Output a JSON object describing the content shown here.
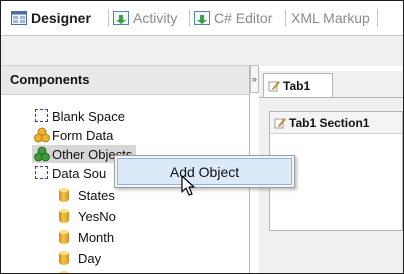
{
  "tabs": [
    {
      "label": "Designer",
      "icon": "designer-icon",
      "active": true
    },
    {
      "label": "Activity",
      "icon": "activity-icon",
      "active": false
    },
    {
      "label": "C# Editor",
      "icon": "csharp-editor-icon",
      "active": false
    },
    {
      "label": "XML Markup",
      "icon": "xml-icon",
      "active": false
    }
  ],
  "components": {
    "title": "Components",
    "collapse_glyph": "»",
    "items": [
      {
        "label": "Blank Space",
        "icon": "dashed-box-icon"
      },
      {
        "label": "Form Data",
        "icon": "shapes-icon"
      },
      {
        "label": "Other Objects",
        "icon": "objects-icon"
      },
      {
        "label": "Data Sou",
        "icon": "dashed-box-icon"
      },
      {
        "label": "States",
        "icon": "data-cylinder-icon"
      },
      {
        "label": "YesNo",
        "icon": "data-cylinder-icon"
      },
      {
        "label": "Month",
        "icon": "data-cylinder-icon"
      },
      {
        "label": "Day",
        "icon": "data-cylinder-icon"
      }
    ]
  },
  "designer": {
    "tab_label": "Tab1",
    "section_label": "Tab1 Section1"
  },
  "context_menu": {
    "items": [
      {
        "label": "Add Object"
      }
    ]
  },
  "colors": {
    "menu_highlight": "#dbe9f8",
    "menu_highlight_border": "#8ab4e4",
    "selected_row": "#d7d7d7"
  }
}
